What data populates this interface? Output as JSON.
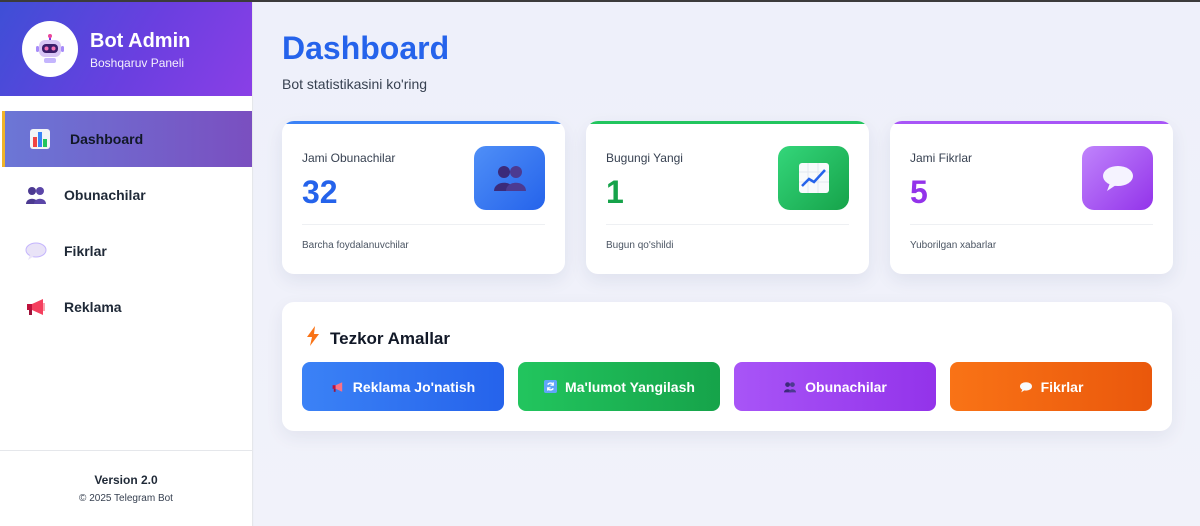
{
  "sidebar": {
    "brand_title": "Bot Admin",
    "brand_subtitle": "Boshqaruv Paneli",
    "items": [
      {
        "label": "Dashboard",
        "icon": "bar-chart-icon"
      },
      {
        "label": "Obunachilar",
        "icon": "users-icon"
      },
      {
        "label": "Fikrlar",
        "icon": "speech-bubble-icon"
      },
      {
        "label": "Reklama",
        "icon": "megaphone-icon"
      }
    ],
    "version": "Version 2.0",
    "copyright": "© 2025 Telegram Bot"
  },
  "main": {
    "title": "Dashboard",
    "subtitle": "Bot statistikasini ko'ring",
    "cards": [
      {
        "label": "Jami Obunachilar",
        "value": "32",
        "note": "Barcha foydalanuvchilar",
        "icon": "users-icon",
        "accent": "#2563eb"
      },
      {
        "label": "Bugungi Yangi",
        "value": "1",
        "note": "Bugun qo'shildi",
        "icon": "chart-up-icon",
        "accent": "#16a34a"
      },
      {
        "label": "Jami Fikrlar",
        "value": "5",
        "note": "Yuborilgan xabarlar",
        "icon": "speech-bubble-icon",
        "accent": "#9333ea"
      }
    ],
    "quick_actions": {
      "title": "Tezkor Amallar",
      "buttons": [
        {
          "label": "Reklama Jo'natish",
          "icon": "megaphone-icon",
          "color": "#2563eb"
        },
        {
          "label": "Ma'lumot Yangilash",
          "icon": "refresh-icon",
          "color": "#16a34a"
        },
        {
          "label": "Obunachilar",
          "icon": "users-icon",
          "color": "#9333ea"
        },
        {
          "label": "Fikrlar",
          "icon": "speech-bubble-icon",
          "color": "#ea580c"
        }
      ]
    }
  }
}
